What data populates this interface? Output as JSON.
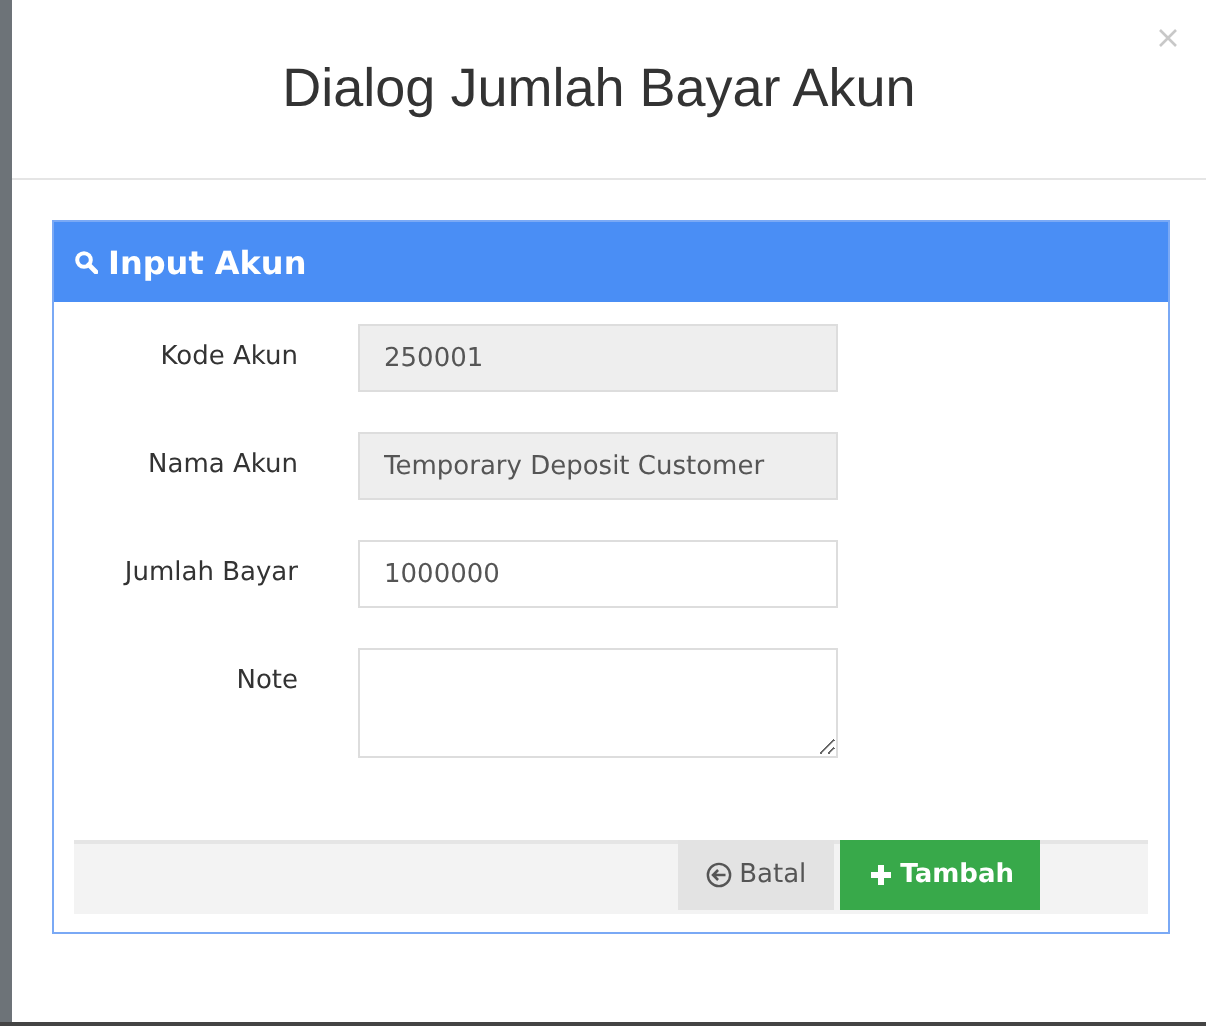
{
  "dialog": {
    "title": "Dialog Jumlah Bayar Akun"
  },
  "panel": {
    "title": "Input Akun",
    "fields": [
      {
        "label": "Kode Akun",
        "kind": "input",
        "value": "250001",
        "disabled": true
      },
      {
        "label": "Nama Akun",
        "kind": "input",
        "value": "Temporary Deposit Customer",
        "disabled": true
      },
      {
        "label": "Jumlah Bayar",
        "kind": "input",
        "value": "1000000",
        "disabled": false
      },
      {
        "label": "Note",
        "kind": "textarea",
        "disabled": false
      }
    ],
    "buttons": [
      {
        "label": "Batal",
        "kind": "cancel"
      },
      {
        "label": "Tambah",
        "kind": "add"
      }
    ]
  }
}
